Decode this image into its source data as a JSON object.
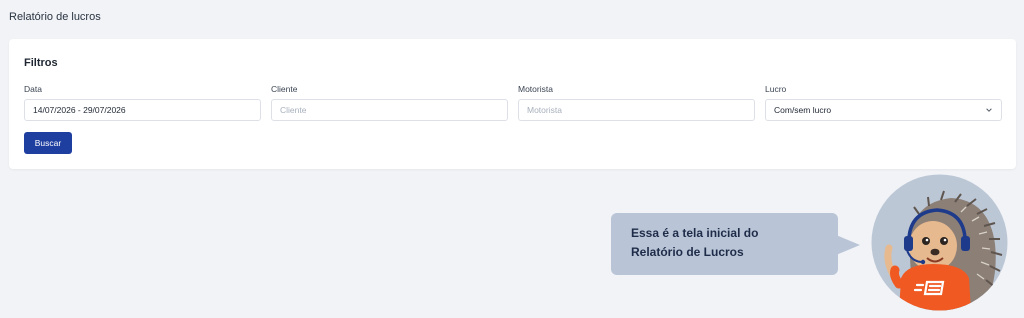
{
  "page": {
    "title": "Relatório de lucros"
  },
  "filters": {
    "title": "Filtros",
    "date": {
      "label": "Data",
      "value": "14/07/2026 - 29/07/2026"
    },
    "client": {
      "label": "Cliente",
      "placeholder": "Cliente"
    },
    "driver": {
      "label": "Motorista",
      "placeholder": "Motorista"
    },
    "profit": {
      "label": "Lucro",
      "value": "Com/sem lucro",
      "icon": "chevron-down-icon"
    },
    "search_button": "Buscar"
  },
  "assistant": {
    "line1": "Essa é a tela inicial do",
    "line2": "Relatório de Lucros"
  },
  "colors": {
    "background": "#f1f3f7",
    "primary": "#1f3fa0",
    "bubble": "#b9c5d6",
    "bubble_text": "#1f2c49",
    "mascot_shirt": "#f05a22",
    "mascot_circle": "#bcc7d6"
  }
}
